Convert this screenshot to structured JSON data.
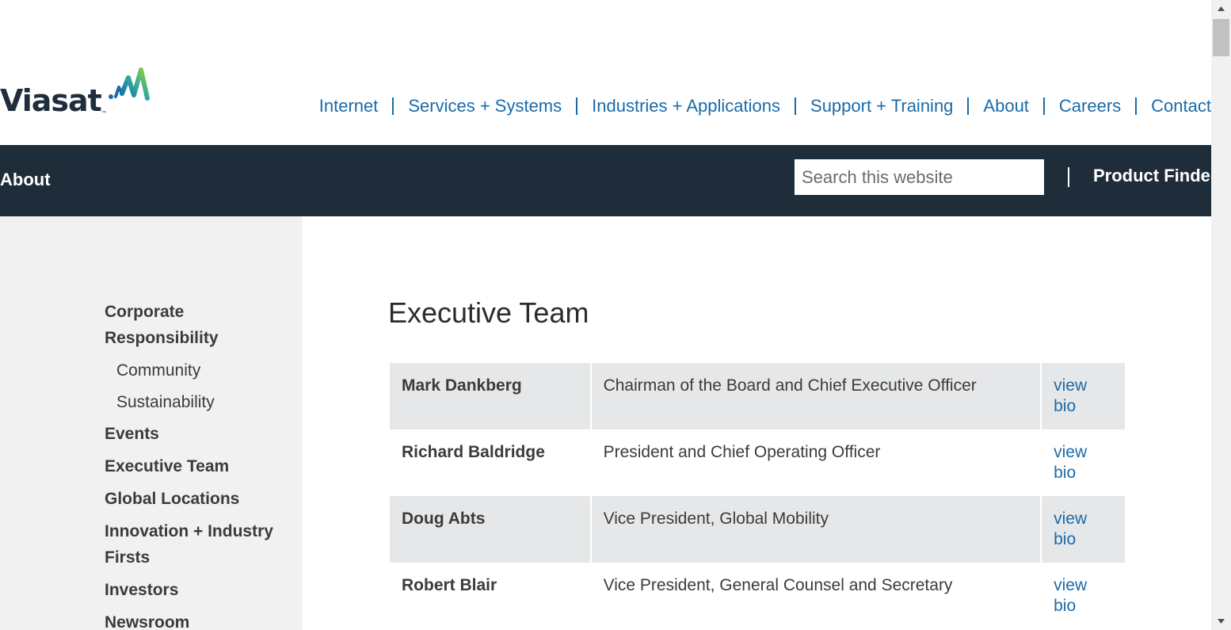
{
  "header": {
    "logo_text": "Viasat",
    "logo_tm": "™",
    "nav": [
      "Internet",
      "Services + Systems",
      "Industries + Applications",
      "Support + Training",
      "About",
      "Careers",
      "Contact"
    ]
  },
  "band": {
    "title": "About",
    "search_placeholder": "Search this website",
    "product_finder": "Product Finder"
  },
  "sidebar": {
    "items": [
      {
        "label": "Corporate Responsibility",
        "type": "section"
      },
      {
        "label": "Community",
        "type": "sub"
      },
      {
        "label": "Sustainability",
        "type": "sub"
      },
      {
        "label": "Events",
        "type": "section"
      },
      {
        "label": "Executive Team",
        "type": "section"
      },
      {
        "label": "Global Locations",
        "type": "section"
      },
      {
        "label": "Innovation + Industry Firsts",
        "type": "section"
      },
      {
        "label": "Investors",
        "type": "section"
      },
      {
        "label": "Newsroom",
        "type": "section"
      }
    ]
  },
  "main": {
    "title": "Executive Team",
    "executives": [
      {
        "name": "Mark Dankberg",
        "title": "Chairman of the Board and Chief Executive Officer",
        "link": "view bio"
      },
      {
        "name": "Richard Baldridge",
        "title": "President and Chief Operating Officer",
        "link": "view bio"
      },
      {
        "name": "Doug Abts",
        "title": "Vice President, Global Mobility",
        "link": "view bio"
      },
      {
        "name": "Robert Blair",
        "title": "Vice President, General Counsel and Secretary",
        "link": "view bio"
      }
    ]
  },
  "colors": {
    "brand_dark": "#1f2d3a",
    "link_blue": "#1a6aa8",
    "sidebar_bg": "#f1f1f1",
    "row_shade": "#e6e7e9"
  }
}
